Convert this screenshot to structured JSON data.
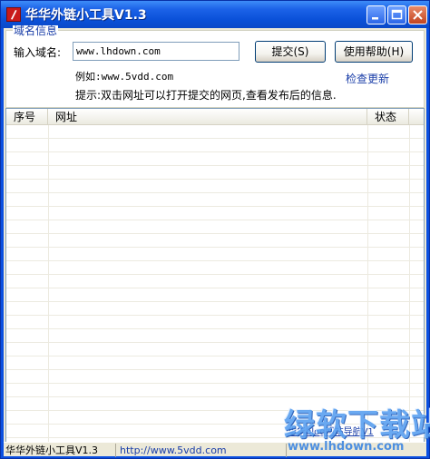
{
  "window": {
    "title": "华华外链小工具V1.3"
  },
  "group": {
    "legend": "域名信息",
    "domain_label": "输入域名:",
    "domain_value": "www.lhdown.com",
    "submit_label": "提交(S)",
    "help_label": "使用帮助(H)",
    "example": "例如:www.5vdd.com",
    "check_update": "检查更新",
    "hint": "提示:双击网址可以打开提交的网页,查看发布后的信息."
  },
  "list": {
    "columns": [
      "序号",
      "网址",
      "状态"
    ],
    "rows": []
  },
  "statusbar": {
    "app_name": "华华外链小工具V1.3",
    "url": "http://www.5vdd.com",
    "blog_link": "华华blog网站导航V1"
  },
  "watermark": {
    "brand": "绿软下载站",
    "url": "www.lhdown.com"
  },
  "colors": {
    "titlebar": "#0A50D8",
    "face": "#ECE9D8",
    "link": "#1A3EA8"
  }
}
